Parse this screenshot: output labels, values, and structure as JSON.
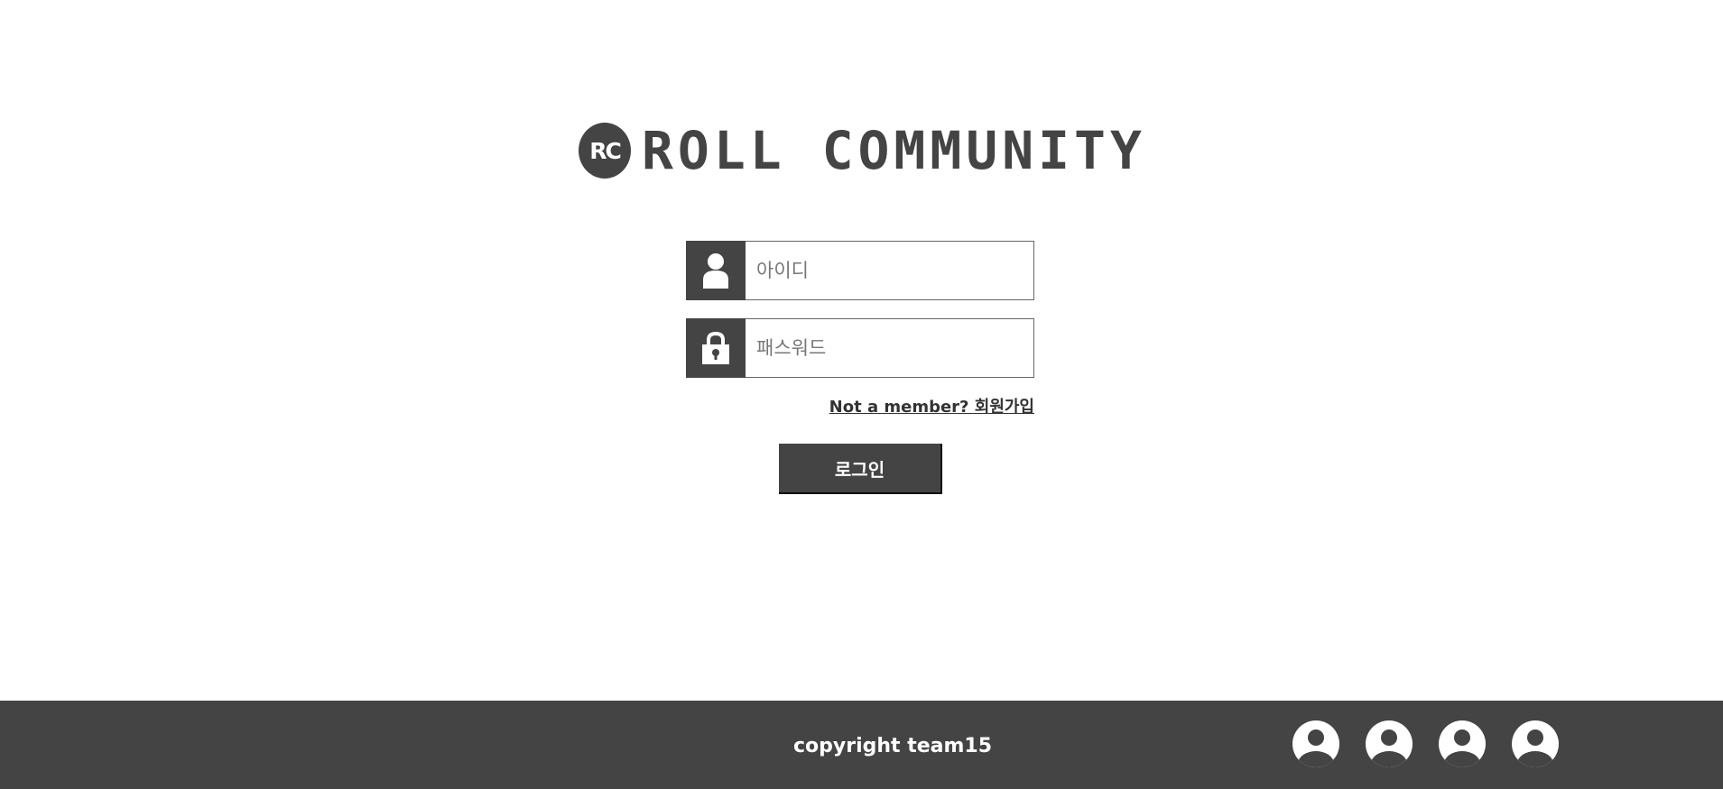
{
  "logo": {
    "badge": "RC",
    "text": "ROLL COMMUNITY"
  },
  "login_form": {
    "username": {
      "icon": "user-icon",
      "placeholder": "아이디",
      "value": ""
    },
    "password": {
      "icon": "lock-icon",
      "placeholder": "패스워드",
      "value": ""
    },
    "signup_link": "Not a member? 회원가입",
    "login_button": "로그인"
  },
  "footer": {
    "copyright": "copyright team15",
    "avatars": [
      "user-avatar-icon",
      "user-avatar-icon",
      "user-avatar-icon",
      "user-avatar-icon"
    ]
  },
  "colors": {
    "primary": "#444444",
    "background": "#ffffff",
    "text": "#333333"
  }
}
